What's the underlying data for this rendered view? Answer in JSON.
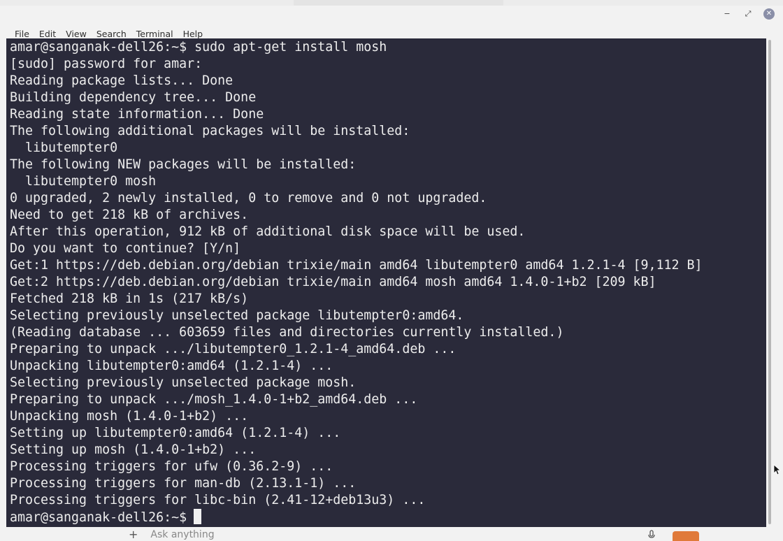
{
  "window": {
    "minimize_label": "−",
    "maximize_label": "⤢",
    "close_label": "✕"
  },
  "menubar": {
    "items": [
      "File",
      "Edit",
      "View",
      "Search",
      "Terminal",
      "Help"
    ]
  },
  "terminal": {
    "lines": [
      "amar@sanganak-dell26:~$ sudo apt-get install mosh",
      "[sudo] password for amar:",
      "Reading package lists... Done",
      "Building dependency tree... Done",
      "Reading state information... Done",
      "The following additional packages will be installed:",
      "  libutempter0",
      "The following NEW packages will be installed:",
      "  libutempter0 mosh",
      "0 upgraded, 2 newly installed, 0 to remove and 0 not upgraded.",
      "Need to get 218 kB of archives.",
      "After this operation, 912 kB of additional disk space will be used.",
      "Do you want to continue? [Y/n]",
      "Get:1 https://deb.debian.org/debian trixie/main amd64 libutempter0 amd64 1.2.1-4 [9,112 B]",
      "Get:2 https://deb.debian.org/debian trixie/main amd64 mosh amd64 1.4.0-1+b2 [209 kB]",
      "Fetched 218 kB in 1s (217 kB/s)",
      "Selecting previously unselected package libutempter0:amd64.",
      "(Reading database ... 603659 files and directories currently installed.)",
      "Preparing to unpack .../libutempter0_1.2.1-4_amd64.deb ...",
      "Unpacking libutempter0:amd64 (1.2.1-4) ...",
      "Selecting previously unselected package mosh.",
      "Preparing to unpack .../mosh_1.4.0-1+b2_amd64.deb ...",
      "Unpacking mosh (1.4.0-1+b2) ...",
      "Setting up libutempter0:amd64 (1.2.1-4) ...",
      "Setting up mosh (1.4.0-1+b2) ...",
      "Processing triggers for ufw (0.36.2-9) ...",
      "Processing triggers for man-db (2.13.1-1) ...",
      "Processing triggers for libc-bin (2.41-12+deb13u3) ..."
    ],
    "prompt": "amar@sanganak-dell26:~$",
    "background_color": "#2a2a3a",
    "text_color": "#ededed"
  },
  "background_app": {
    "plus_label": "+",
    "input_placeholder": "Ask anything"
  }
}
